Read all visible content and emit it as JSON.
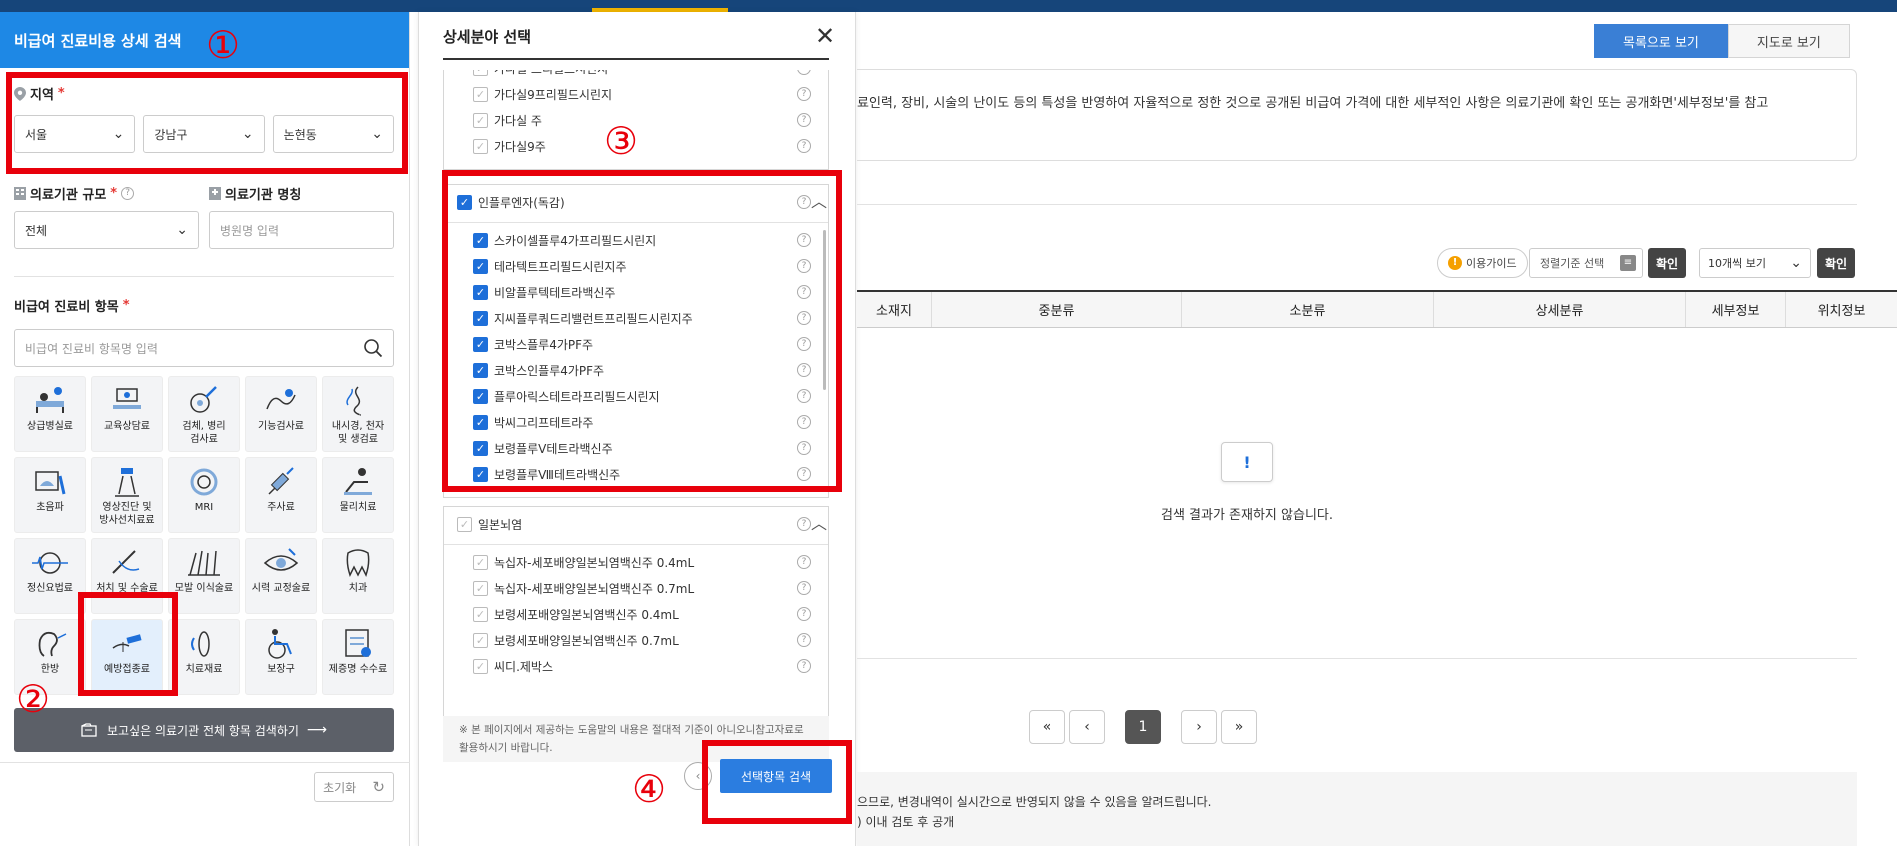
{
  "left": {
    "title": "비급여 진료비용 상세 검색",
    "region_label": "지역",
    "region": [
      "서울",
      "강남구",
      "논현동"
    ],
    "size_label": "의료기관 규모",
    "size_value": "전체",
    "name_label": "의료기관 명칭",
    "name_placeholder": "병원명 입력",
    "items_label": "비급여 진료비 항목",
    "items_placeholder": "비급여 진료비 항목명 입력",
    "categories": [
      {
        "name": "상급병실료",
        "icon": "hospital-bed-icon"
      },
      {
        "name": "교육상담료",
        "icon": "consultation-icon"
      },
      {
        "name": "검체, 병리\n검사료",
        "icon": "specimen-test-icon"
      },
      {
        "name": "기능검사료",
        "icon": "function-test-icon"
      },
      {
        "name": "내시경, 천자\n및 생검료",
        "icon": "endoscope-icon"
      },
      {
        "name": "초음파",
        "icon": "ultrasound-icon"
      },
      {
        "name": "영상진단 및\n방사선치료료",
        "icon": "radiology-icon"
      },
      {
        "name": "MRI",
        "icon": "mri-icon"
      },
      {
        "name": "주사료",
        "icon": "syringe-icon"
      },
      {
        "name": "물리치료",
        "icon": "physical-therapy-icon"
      },
      {
        "name": "정신요법료",
        "icon": "brain-wave-icon"
      },
      {
        "name": "처치 및 수술료",
        "icon": "surgery-icon"
      },
      {
        "name": "모발 이식술료",
        "icon": "hair-transplant-icon"
      },
      {
        "name": "시력 교정술료",
        "icon": "eye-icon"
      },
      {
        "name": "치과",
        "icon": "tooth-icon"
      },
      {
        "name": "한방",
        "icon": "ear-acupuncture-icon"
      },
      {
        "name": "예방접종료",
        "icon": "vaccine-icon",
        "active": true
      },
      {
        "name": "치료재료",
        "icon": "lens-icon"
      },
      {
        "name": "보장구",
        "icon": "wheelchair-icon"
      },
      {
        "name": "제증명 수수료",
        "icon": "certificate-icon"
      }
    ],
    "all_search_btn": "보고싶은 의료기관 전체 항목 검색하기",
    "reset_btn": "초기화"
  },
  "modal": {
    "title": "상세분야 선택",
    "top_items": [
      "가다실 프리필드시린지",
      "가다실9프리필드시린지",
      "가다실 주",
      "가다실9주"
    ],
    "group1": {
      "label": "인플루엔자(독감)",
      "items": [
        "스카이셀플루4가프리필드시린지",
        "테라텍트프리필드시린지주",
        "비알플루텍테트라백신주",
        "지씨플루쿼드리밸런트프리필드시린지주",
        "코박스플루4가PF주",
        "코박스인플루4가PF주",
        "플루아릭스테트라프리필드시린지",
        "박씨그리프테트라주",
        "보령플루Ⅴ테트라백신주",
        "보령플루Ⅷ테트라백신주"
      ]
    },
    "group2": {
      "label": "일본뇌염",
      "items": [
        "녹십자-세포배양일본뇌염백신주 0.4mL",
        "녹십자-세포배양일본뇌염백신주 0.7mL",
        "보령세포배양일본뇌염백신주 0.4mL",
        "보령세포배양일본뇌염백신주 0.7mL",
        "씨디.제박스"
      ]
    },
    "help_glyph": "?",
    "note": "※ 본 페이지에서 제공하는 도움말의 내용은 절대적 기준이 아니오니참고자료로 활용하시기 바랍니다.",
    "search_btn": "선택항목 검색"
  },
  "right": {
    "view_list": "목록으로 보기",
    "view_map": "지도로 보기",
    "info_text": "료인력, 장비, 시술의 난이도 등의 특성을 반영하여 자율적으로 정한 것으로 공개된 비급여 가격에 대한 세부적인 사항은 의료기관에 확인 또는 공개화면'세부정보'를 참고",
    "guide": "이용가이드",
    "sort": "정렬기준 선택",
    "confirm": "확인",
    "count": "10개씩 보기",
    "columns": [
      "소재지",
      "중분류",
      "소분류",
      "상세분류",
      "세부정보",
      "위치정보"
    ],
    "empty_msg": "검색 결과가 존재하지 않습니다.",
    "page": "1",
    "footer_line1": "으므로, 변경내역이 실시간으로 반영되지 않을 수 있음을 알려드립니다.",
    "footer_line2": ") 이내 검토 후 공개"
  },
  "annotations": [
    "①",
    "②",
    "③",
    "④"
  ],
  "colors": {
    "header_blue": "#1e88e5",
    "annotation_red": "#e8000b",
    "check_blue": "#1e6fd9"
  }
}
